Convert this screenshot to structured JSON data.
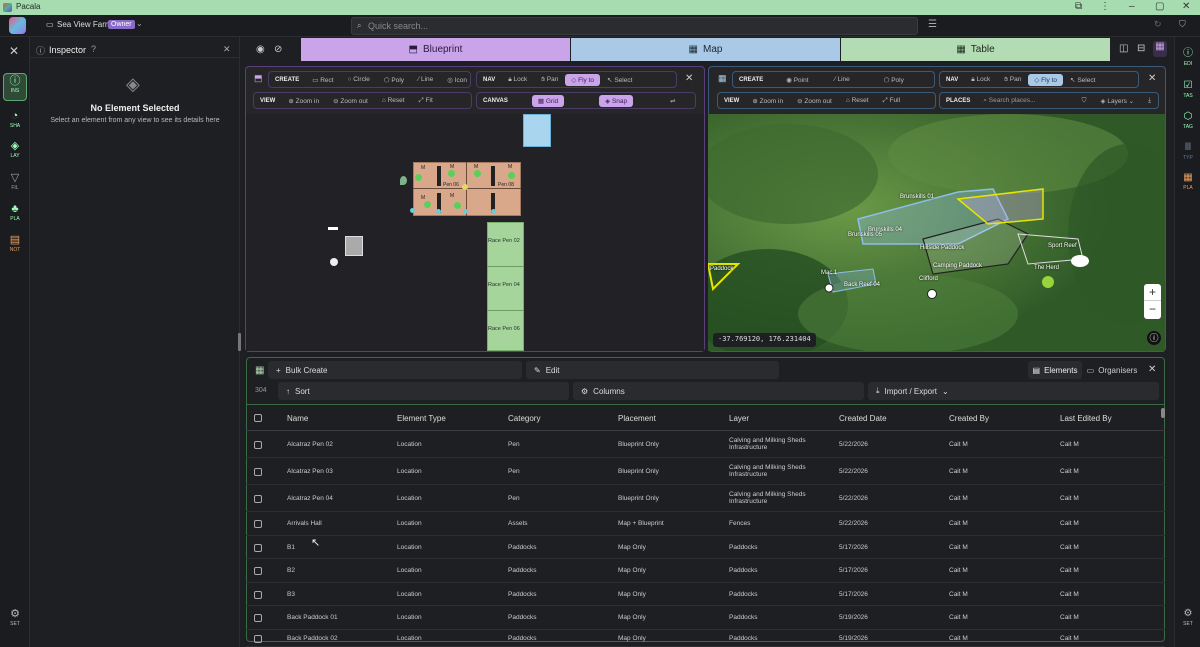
{
  "window": {
    "title": "Pacala"
  },
  "header": {
    "farm_name": "Sea View Farm",
    "role_badge": "Owner",
    "search_placeholder": "Quick search..."
  },
  "left_rail": [
    {
      "label": "INS",
      "icon": "info-icon"
    },
    {
      "label": "SHA",
      "icon": "shapes-icon"
    },
    {
      "label": "LAY",
      "icon": "layers-icon"
    },
    {
      "label": "FIL",
      "icon": "filter-icon"
    },
    {
      "label": "PLA",
      "icon": "tree-icon"
    },
    {
      "label": "NOT",
      "icon": "note-icon"
    },
    {
      "label": "SET",
      "icon": "gear-icon"
    }
  ],
  "right_rail": [
    {
      "label": "EDI",
      "icon": "info-icon"
    },
    {
      "label": "TAS",
      "icon": "task-icon"
    },
    {
      "label": "TAG",
      "icon": "tag-icon"
    },
    {
      "label": "TYP",
      "icon": "type-icon"
    },
    {
      "label": "PLA",
      "icon": "grid-icon"
    },
    {
      "label": "SET",
      "icon": "gear-icon"
    }
  ],
  "inspector": {
    "title": "Inspector",
    "empty_title": "No Element Selected",
    "empty_text": "Select an element from any view to see its details here"
  },
  "tabs": [
    {
      "label": "Blueprint",
      "color": "#c9a4e8"
    },
    {
      "label": "Map",
      "color": "#a9c9e6"
    },
    {
      "label": "Table",
      "color": "#b3dcb5"
    }
  ],
  "blueprint": {
    "create_label": "CREATE",
    "create": [
      "Rect",
      "Circle",
      "Poly",
      "Line",
      "Icon"
    ],
    "nav_label": "NAV",
    "nav": [
      "Lock",
      "Pan",
      "Fly to",
      "Select"
    ],
    "view_label": "VIEW",
    "view": [
      "Zoom in",
      "Zoom out",
      "Reset",
      "Fit"
    ],
    "canvas_label": "CANVAS",
    "canvas": [
      "Grid",
      "Snap"
    ],
    "pens": [
      "Pen 06",
      "Pen 08"
    ],
    "races": [
      "Race Pen 02",
      "Race Pen 04",
      "Race Pen 06"
    ],
    "marker": "M"
  },
  "map": {
    "create_label": "CREATE",
    "create": [
      "Point",
      "Line",
      "Poly"
    ],
    "nav_label": "NAV",
    "nav": [
      "Lock",
      "Pan",
      "Fly to",
      "Select"
    ],
    "view_label": "VIEW",
    "view": [
      "Zoom in",
      "Zoom out",
      "Reset",
      "Full"
    ],
    "places_label": "PLACES",
    "places_placeholder": "Search places...",
    "layers": "Layers",
    "coords": "-37.769120, 176.231404",
    "labels": [
      "Brunskills 01",
      "Brunskills 04",
      "Brunskills 05",
      "Hillside Paddock",
      "Camping Paddock",
      "Sport Reef",
      "The Herd",
      "Back Reef 04",
      "Paddock",
      "Mac 1",
      "Clifford"
    ],
    "zoom_in": "+",
    "zoom_out": "−"
  },
  "table": {
    "bulk_create": "Bulk Create",
    "edit": "Edit",
    "count": "304",
    "sort": "Sort",
    "columns_btn": "Columns",
    "import_export": "Import / Export",
    "elements_tab": "Elements",
    "organisers_tab": "Organisers",
    "columns": [
      "Name",
      "Element Type",
      "Category",
      "Placement",
      "Layer",
      "Created Date",
      "Created By",
      "Last Edited By"
    ],
    "rows": [
      [
        "Alcatraz Pen 02",
        "Location",
        "Pen",
        "Blueprint Only",
        "Calving and Milking Sheds Infrastructure",
        "5/22/2026",
        "Cait M",
        "Cait M"
      ],
      [
        "Alcatraz Pen 03",
        "Location",
        "Pen",
        "Blueprint Only",
        "Calving and Milking Sheds Infrastructure",
        "5/22/2026",
        "Cait M",
        "Cait M"
      ],
      [
        "Alcatraz Pen 04",
        "Location",
        "Pen",
        "Blueprint Only",
        "Calving and Milking Sheds Infrastructure",
        "5/22/2026",
        "Cait M",
        "Cait M"
      ],
      [
        "Arrivals Hall",
        "Location",
        "Assets",
        "Map + Blueprint",
        "Fences",
        "5/22/2026",
        "Cait M",
        "Cait M"
      ],
      [
        "B1",
        "Location",
        "Paddocks",
        "Map Only",
        "Paddocks",
        "5/17/2026",
        "Cait M",
        "Cait M"
      ],
      [
        "B2",
        "Location",
        "Paddocks",
        "Map Only",
        "Paddocks",
        "5/17/2026",
        "Cait M",
        "Cait M"
      ],
      [
        "B3",
        "Location",
        "Paddocks",
        "Map Only",
        "Paddocks",
        "5/17/2026",
        "Cait M",
        "Cait M"
      ],
      [
        "Back Paddock 01",
        "Location",
        "Paddocks",
        "Map Only",
        "Paddocks",
        "5/19/2026",
        "Cait M",
        "Cait M"
      ],
      [
        "Back Paddock 02",
        "Location",
        "Paddocks",
        "Map Only",
        "Paddocks",
        "5/19/2026",
        "Cait M",
        "Cait M"
      ]
    ]
  }
}
